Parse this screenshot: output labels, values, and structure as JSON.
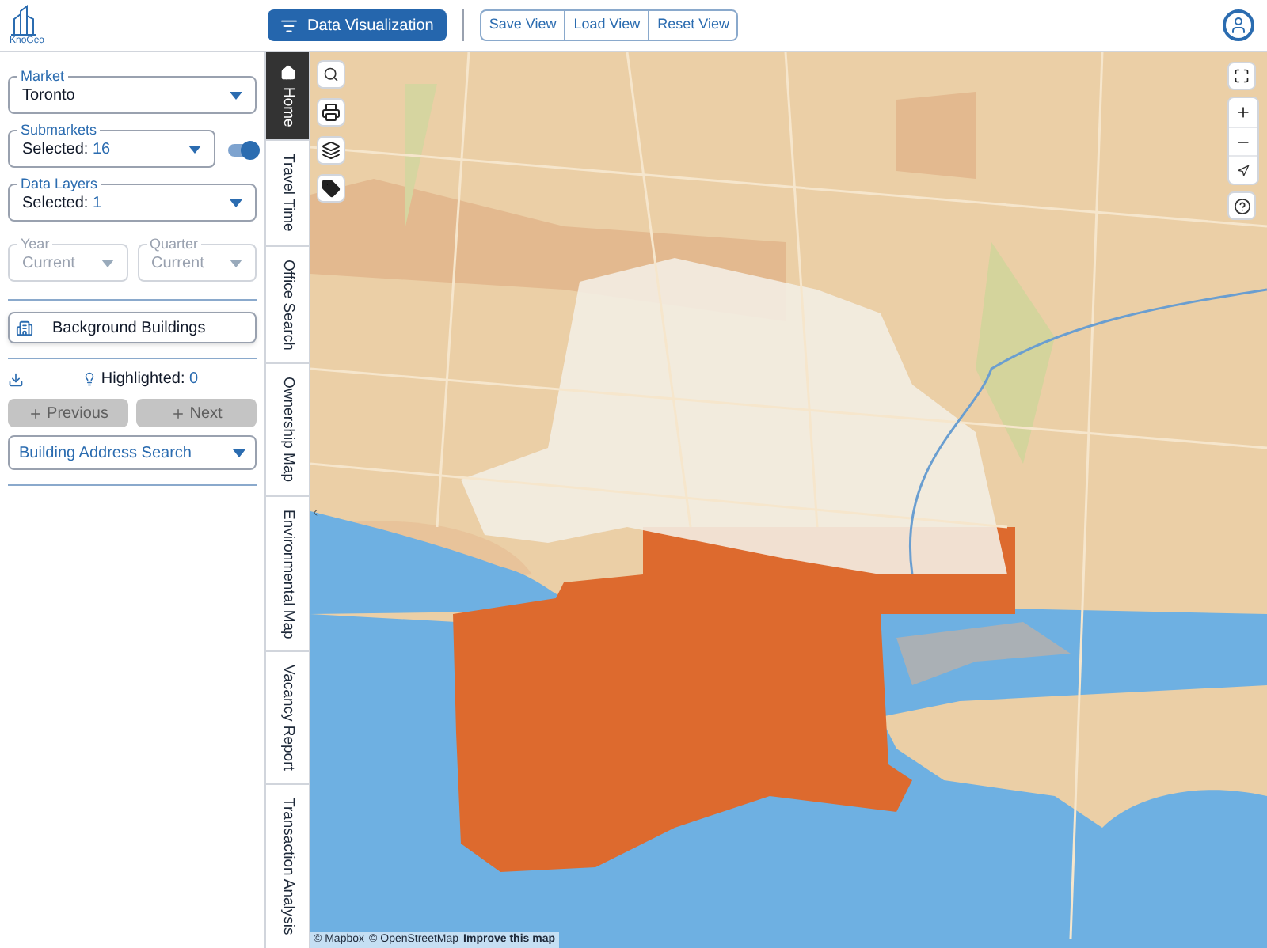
{
  "header": {
    "logo_text": "KnoGeo",
    "primary_button": "Data Visualization",
    "view_buttons": [
      "Save View",
      "Load View",
      "Reset View"
    ]
  },
  "sidebar": {
    "market": {
      "label": "Market",
      "value": "Toronto"
    },
    "submarkets": {
      "label": "Submarkets",
      "prefix": "Selected:",
      "count": "16",
      "toggle_on": true
    },
    "data_layers": {
      "label": "Data Layers",
      "prefix": "Selected:",
      "count": "1"
    },
    "year": {
      "label": "Year",
      "value": "Current",
      "disabled": true
    },
    "quarter": {
      "label": "Quarter",
      "value": "Current",
      "disabled": true
    },
    "background_button": "Background Buildings",
    "highlighted": {
      "label": "Highlighted:",
      "count": "0"
    },
    "nav_buttons": [
      {
        "label": "Previous",
        "disabled": true
      },
      {
        "label": "Next",
        "disabled": true
      }
    ],
    "address_search": "Building Address Search"
  },
  "tabs": [
    {
      "label": "Home",
      "selected": true
    },
    {
      "label": "Travel Time",
      "selected": false
    },
    {
      "label": "Office Search",
      "selected": false
    },
    {
      "label": "Ownership Map",
      "selected": false
    },
    {
      "label": "Environmental Map",
      "selected": false
    },
    {
      "label": "Vacancy Report",
      "selected": false
    },
    {
      "label": "Transaction Analysis",
      "selected": false
    }
  ],
  "map": {
    "attribution": [
      "© Mapbox",
      "© OpenStreetMap"
    ],
    "improve_link": "Improve this map"
  }
}
